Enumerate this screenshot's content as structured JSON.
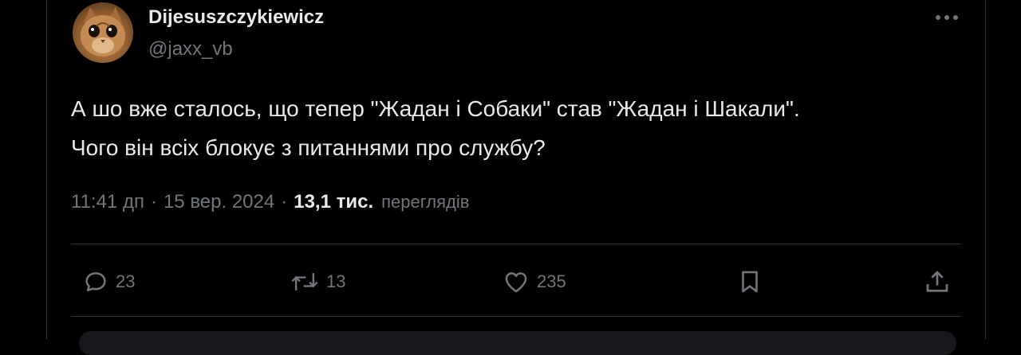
{
  "author": {
    "display_name": "Dijesuszczykiewicz",
    "handle": "@jaxx_vb",
    "avatar": "cat-avatar"
  },
  "tweet": {
    "lines": [
      "А шо вже сталось, що тепер \"Жадан і Собаки\" став \"Жадан і Шакали\".",
      "Чого він всіх блокує з питаннями про службу?"
    ]
  },
  "meta": {
    "time": "11:41 дп",
    "separator": "·",
    "date": "15 вер. 2024",
    "views_count": "13,1 тис.",
    "views_label": "переглядів"
  },
  "actions": {
    "reply_count": "23",
    "repost_count": "13",
    "like_count": "235",
    "icons": [
      "reply-icon",
      "repost-icon",
      "like-icon",
      "bookmark-icon",
      "share-icon"
    ]
  },
  "colors": {
    "background": "#000000",
    "text": "#e7e9ea",
    "secondary": "#71767b",
    "border": "#2f3336"
  }
}
